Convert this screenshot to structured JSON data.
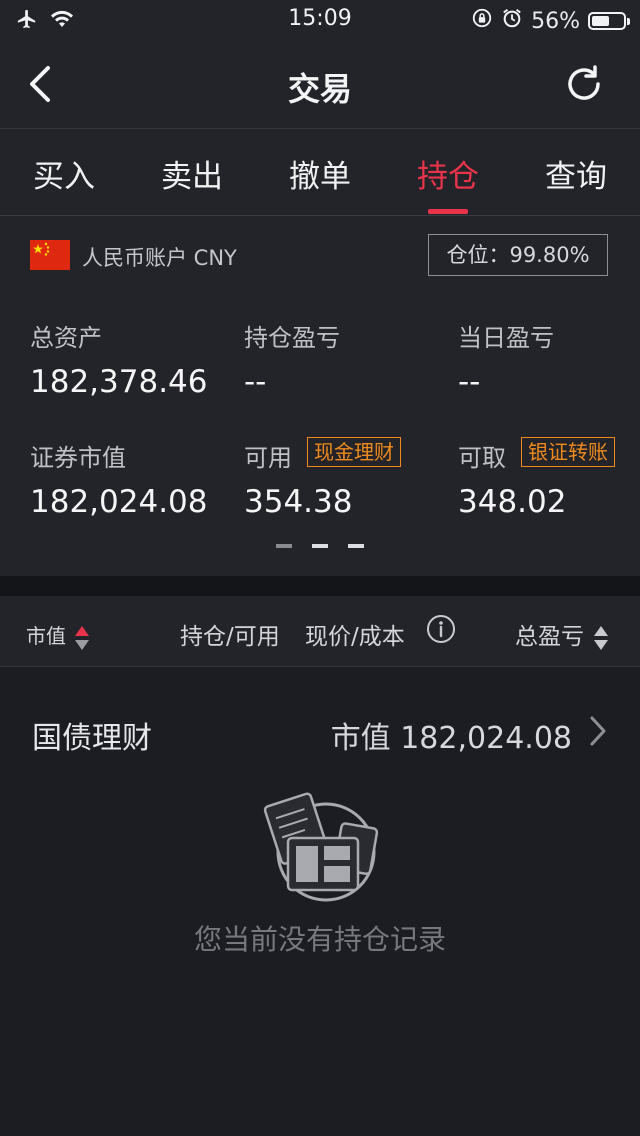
{
  "status_bar": {
    "time": "15:09",
    "battery_percent": "56%",
    "battery_level": 0.56
  },
  "nav": {
    "title": "交易"
  },
  "tabs": [
    {
      "label": "买入",
      "active": false
    },
    {
      "label": "卖出",
      "active": false
    },
    {
      "label": "撤单",
      "active": false
    },
    {
      "label": "持仓",
      "active": true
    },
    {
      "label": "查询",
      "active": false
    }
  ],
  "account": {
    "currency_label": "人民币账户 CNY",
    "position_ratio": "仓位：99.80%"
  },
  "metrics": {
    "total_assets_label": "总资产",
    "total_assets_value": "182,378.46",
    "holding_pl_label": "持仓盈亏",
    "holding_pl_value": "--",
    "daily_pl_label": "当日盈亏",
    "daily_pl_value": "--",
    "market_value_label": "证券市值",
    "market_value_value": "182,024.08",
    "available_label": "可用",
    "available_value": "354.38",
    "cash_mgmt_button": "现金理财",
    "withdrawable_label": "可取",
    "withdrawable_value": "348.02",
    "bank_transfer_button": "银证转账"
  },
  "table_header": {
    "market_value": "市值",
    "holding_available": "持仓/可用",
    "price_cost": "现价/成本",
    "total_pl": "总盈亏"
  },
  "bond": {
    "title": "国债理财",
    "value": "市值 182,024.08"
  },
  "empty_state": {
    "message": "您当前没有持仓记录"
  },
  "colors": {
    "accent_red": "#e8334a",
    "orange": "#f08a1c",
    "background": "#1c1d22",
    "panel": "#232429"
  }
}
